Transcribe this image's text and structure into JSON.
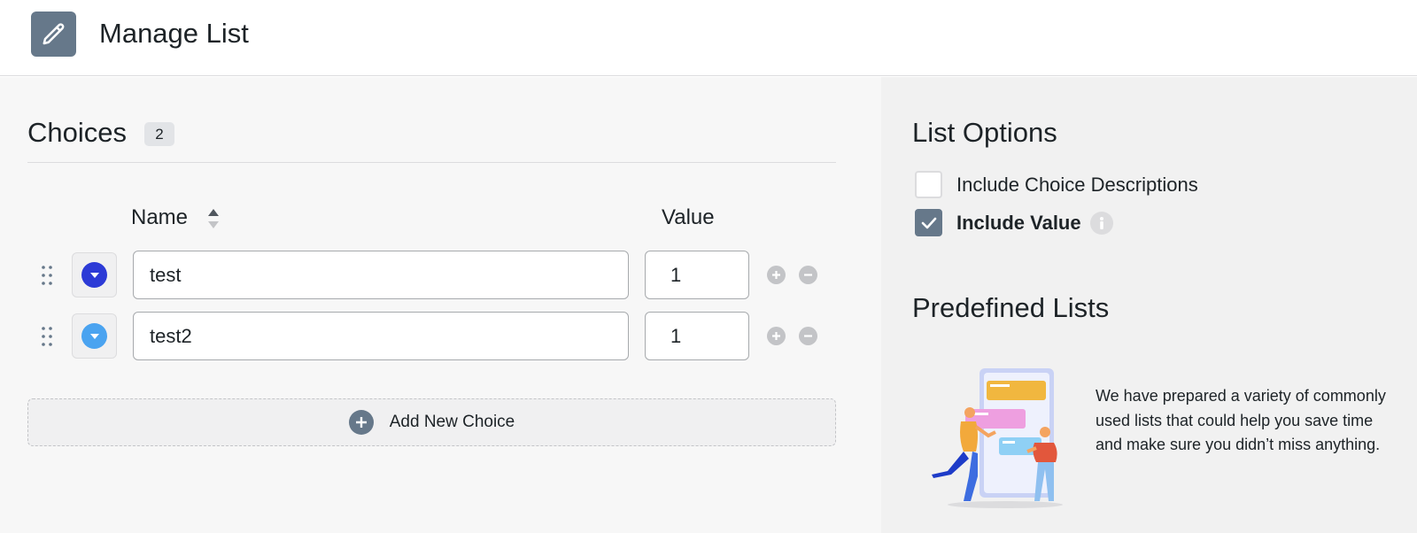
{
  "header": {
    "title": "Manage List",
    "icon": "pencil-icon"
  },
  "choices": {
    "title": "Choices",
    "count": "2",
    "columns": {
      "name": "Name",
      "value": "Value"
    },
    "rows": [
      {
        "name": "test",
        "value": "1",
        "color": "#2c3ad6"
      },
      {
        "name": "test2",
        "value": "1",
        "color": "#4aa3f0"
      }
    ],
    "add_label": "Add New Choice"
  },
  "list_options": {
    "title": "List Options",
    "options": [
      {
        "label": "Include Choice Descriptions",
        "checked": false
      },
      {
        "label": "Include Value",
        "checked": true
      }
    ]
  },
  "predefined": {
    "title": "Predefined Lists",
    "description": "We have prepared a variety of commonly used lists that could help you save time and make sure you didn’t miss anything."
  },
  "colors": {
    "accent": "#66788a",
    "muted": "#c3c4c7"
  }
}
